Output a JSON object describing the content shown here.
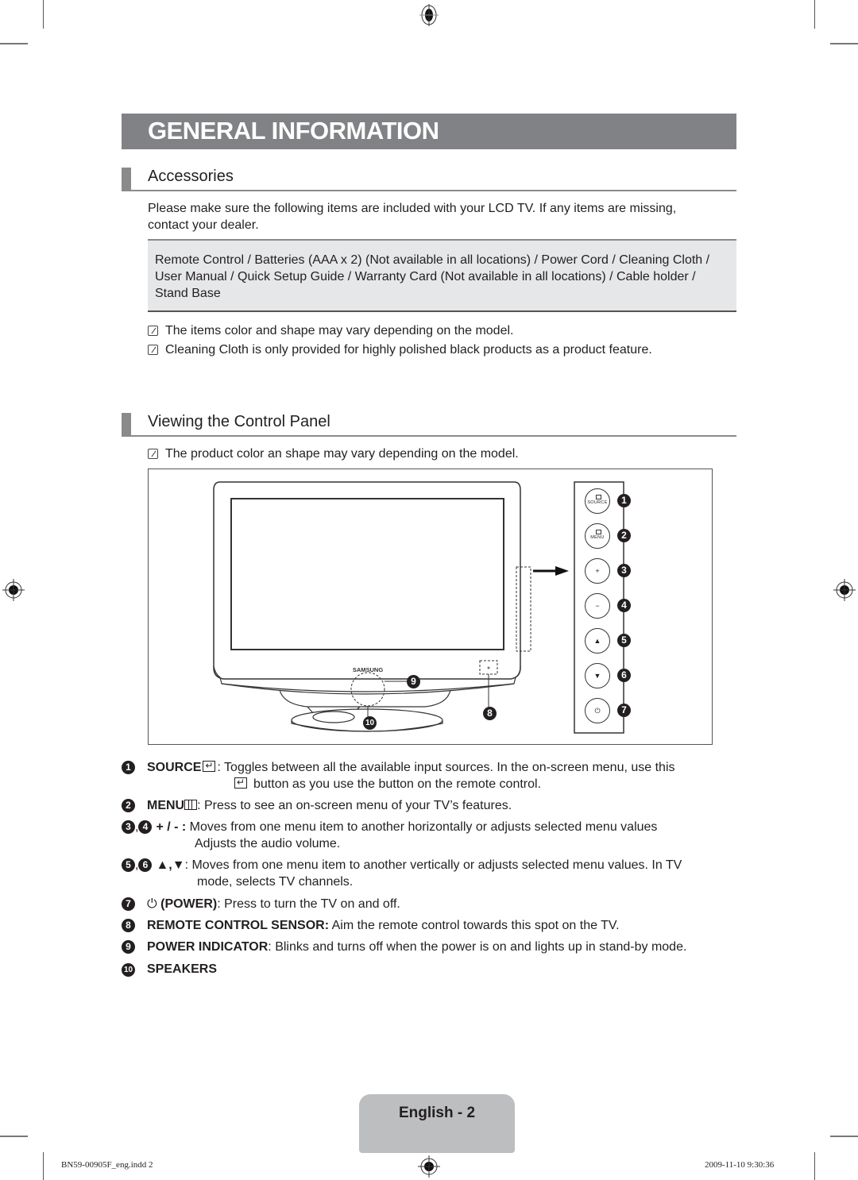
{
  "page": {
    "title": "GENERAL INFORMATION",
    "sections": {
      "accessories": {
        "heading": "Accessories",
        "intro": "Please make sure the following items are included with your LCD TV. If any items are missing, contact your dealer.",
        "items_box": "Remote Control / Batteries (AAA x 2) (Not available in all locations) / Power Cord / Cleaning Cloth / User Manual / Quick Setup Guide / Warranty Card (Not available in all locations) / Cable holder / Stand Base",
        "notes": [
          "The items color and shape may vary depending on the model.",
          "Cleaning Cloth is only provided for highly polished black products as a product feature."
        ]
      },
      "control_panel": {
        "heading": "Viewing the Control Panel",
        "note": "The product color an shape may vary depending on the model.",
        "diagram": {
          "brand": "SAMSUNG",
          "buttons": [
            {
              "num": "1",
              "label": "SOURCE",
              "icon": "source-icon"
            },
            {
              "num": "2",
              "label": "MENU",
              "icon": "menu-icon"
            },
            {
              "num": "3",
              "label": "+",
              "icon": "plus-icon"
            },
            {
              "num": "4",
              "label": "−",
              "icon": "minus-icon"
            },
            {
              "num": "5",
              "label": "▲",
              "icon": "up-triangle-icon"
            },
            {
              "num": "6",
              "label": "▼",
              "icon": "down-triangle-icon"
            },
            {
              "num": "7",
              "label": "⏻",
              "icon": "power-icon"
            }
          ],
          "callouts": {
            "sensor": "8",
            "indicator": "9",
            "speakers": "10"
          }
        },
        "descriptions": [
          {
            "nums": [
              "1"
            ],
            "key": "SOURCE",
            "text": ": Toggles between all the available input sources. In the on-screen menu, use this",
            "text2": "button as you use the button on the remote control."
          },
          {
            "nums": [
              "2"
            ],
            "key": "MENU",
            "text": ": Press to see an on-screen menu of your TV’s features."
          },
          {
            "nums": [
              "3",
              "4"
            ],
            "key": "+ / - :",
            "text": " Moves from one menu item to another horizontally or adjusts selected menu values",
            "text2": "Adjusts the audio volume."
          },
          {
            "nums": [
              "5",
              "6"
            ],
            "key": "▲,▼",
            "text": ": Moves from one menu item to another vertically or adjusts selected menu values. In TV",
            "text2": "mode, selects TV channels."
          },
          {
            "nums": [
              "7"
            ],
            "key": "(POWER)",
            "text": ": Press to turn the TV on and off."
          },
          {
            "nums": [
              "8"
            ],
            "key": "REMOTE CONTROL SENSOR:",
            "text": " Aim the remote control towards this spot on the TV."
          },
          {
            "nums": [
              "9"
            ],
            "key": "POWER INDICATOR",
            "text": ": Blinks and turns off when the power is on and lights up in stand-by mode."
          },
          {
            "nums": [
              "10"
            ],
            "key": "SPEAKERS",
            "text": ""
          }
        ]
      }
    },
    "page_label": "English - 2",
    "slug": {
      "file": "BN59-00905F_eng.indd   2",
      "timestamp": "2009-11-10   9:30:36"
    }
  }
}
